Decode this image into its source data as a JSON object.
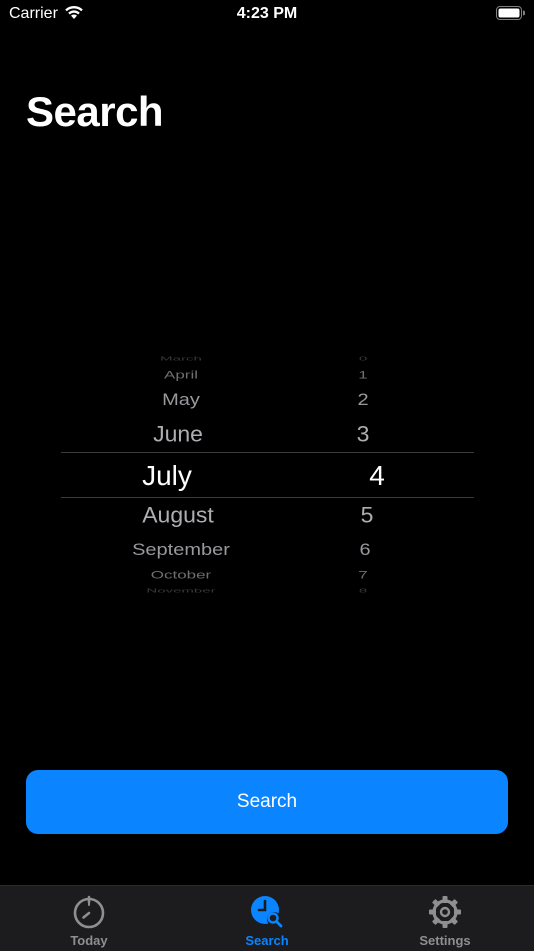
{
  "status_bar": {
    "carrier": "Carrier",
    "time": "4:23 PM"
  },
  "page": {
    "title": "Search"
  },
  "picker": {
    "months": [
      "March",
      "April",
      "May",
      "June",
      "July",
      "August",
      "September",
      "October",
      "November"
    ],
    "days": [
      "0",
      "1",
      "2",
      "3",
      "4",
      "5",
      "6",
      "7",
      "8"
    ],
    "selected_month": "July",
    "selected_day": "4"
  },
  "search_button": {
    "label": "Search"
  },
  "tab_bar": {
    "tabs": [
      {
        "label": "Today",
        "icon": "timer-icon",
        "active": false
      },
      {
        "label": "Search",
        "icon": "clock-search-icon",
        "active": true
      },
      {
        "label": "Settings",
        "icon": "gear-icon",
        "active": false
      }
    ]
  },
  "colors": {
    "accent": "#0a84ff",
    "inactive": "#8e8e93",
    "background": "#000000",
    "tab_bar_background": "#1c1c1e"
  }
}
